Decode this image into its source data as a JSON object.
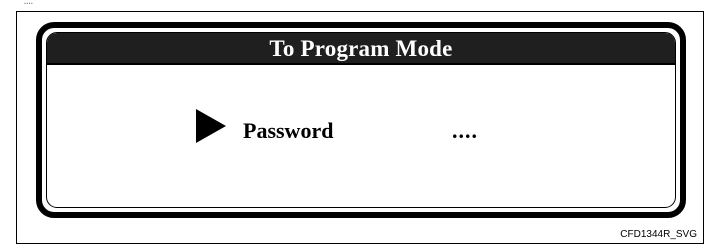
{
  "display": {
    "title": "To Program Mode",
    "field_label": "Password",
    "field_value": "....",
    "cursor_icon": "triangle-right-icon"
  },
  "figure": {
    "code": "CFD1344R_SVG"
  }
}
